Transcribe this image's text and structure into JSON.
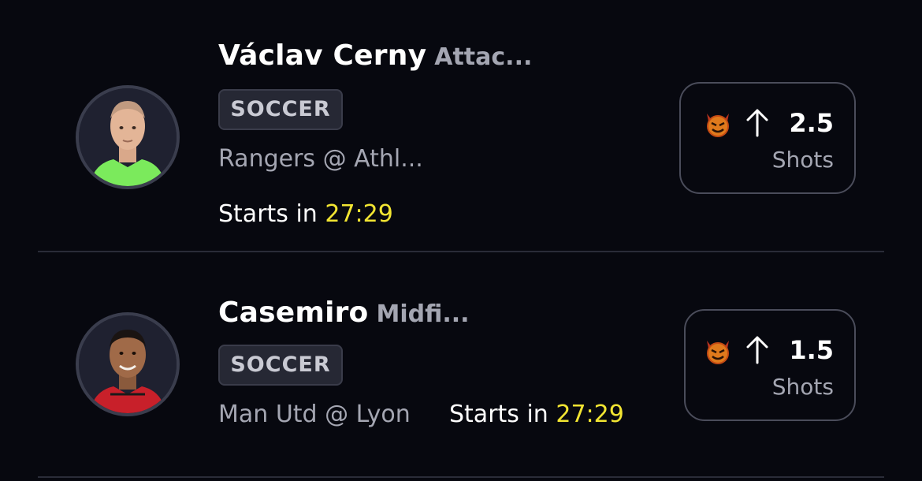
{
  "picks": [
    {
      "player_name": "Václav Cerny",
      "position": "Attac...",
      "sport": "SOCCER",
      "matchup": "Rangers @ Athl...",
      "starts_label": "Starts in",
      "start_time": "27:29",
      "direction_icon": "arrow-up-icon",
      "badge_icon": "devil-emoji-icon",
      "line": "2.5",
      "stat": "Shots",
      "jersey_color": "#7bea5c"
    },
    {
      "player_name": "Casemiro",
      "position": "Midfi...",
      "sport": "SOCCER",
      "matchup": "Man Utd @ Lyon",
      "starts_label": "Starts in",
      "start_time": "27:29",
      "direction_icon": "arrow-up-icon",
      "badge_icon": "devil-emoji-icon",
      "line": "1.5",
      "stat": "Shots",
      "jersey_color": "#c8202a"
    }
  ],
  "colors": {
    "background": "#07080f",
    "time_highlight": "#f2e532",
    "muted_text": "#a4a6b2",
    "divider": "#2a2c38"
  }
}
